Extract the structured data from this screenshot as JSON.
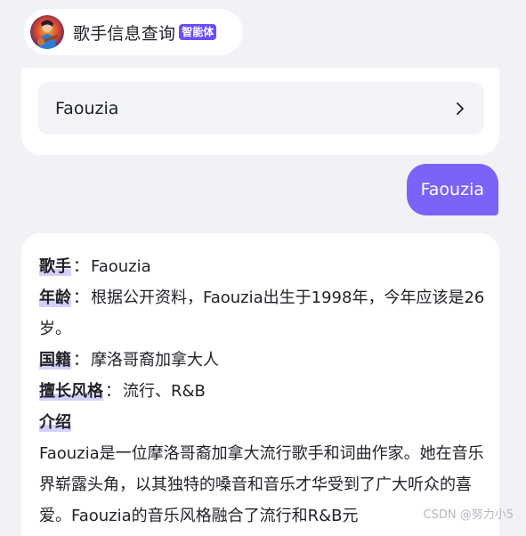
{
  "header": {
    "title": "歌手信息查询",
    "badge": "智能体"
  },
  "suggestion": {
    "text": "Faouzia"
  },
  "user_message": {
    "text": "Faouzia"
  },
  "answer": {
    "singer_label": "歌手",
    "singer_value": "Faouzia",
    "age_label": "年龄",
    "age_value": "根据公开资料，Faouzia出生于1998年，今年应该是26岁。",
    "nationality_label": "国籍",
    "nationality_value": "摩洛哥裔加拿大人",
    "style_label": "擅长风格",
    "style_value": "流行、R&B",
    "intro_title": "介绍",
    "intro_body": "Faouzia是一位摩洛哥裔加拿大流行歌手和词曲作家。她在音乐界崭露头角，以其独特的嗓音和音乐才华受到了广大听众的喜爱。Faouzia的音乐风格融合了流行和R&B元"
  },
  "watermark": {
    "text": "CSDN @努力小5"
  },
  "colors": {
    "accent": "#6b4dfa",
    "user_bubble": "#7a63f8",
    "label_highlight": "#d4d0fb"
  }
}
